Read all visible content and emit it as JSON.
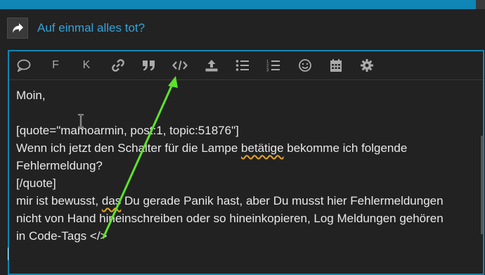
{
  "topic": {
    "title": "Auf einmal alles tot?",
    "reply_icon": "share-arrow-icon"
  },
  "toolbar": {
    "buttons": [
      {
        "name": "quote-bubble-icon",
        "label": ""
      },
      {
        "name": "bold-button",
        "label": "F"
      },
      {
        "name": "italic-button",
        "label": "K"
      },
      {
        "name": "link-icon",
        "label": ""
      },
      {
        "name": "blockquote-icon",
        "label": ""
      },
      {
        "name": "code-icon",
        "label": ""
      },
      {
        "name": "upload-icon",
        "label": ""
      },
      {
        "name": "bullet-list-icon",
        "label": ""
      },
      {
        "name": "numbered-list-icon",
        "label": ""
      },
      {
        "name": "emoji-icon",
        "label": ""
      },
      {
        "name": "calendar-icon",
        "label": ""
      },
      {
        "name": "gear-icon",
        "label": ""
      }
    ]
  },
  "editor": {
    "lines": {
      "l1": "Moin,",
      "l2": "",
      "l3": "[quote=\"mamoarmin, post:1, topic:51876\"]",
      "l4a": "Wenn ich jetzt den Schalter für die Lampe ",
      "l4b": "betätige",
      "l4c": " bekomme ich folgende",
      "l5": "Fehlermeldung?",
      "l6": "[/quote]",
      "l7a": "mir ist bewusst, ",
      "l7b": "das",
      "l7c": " Du gerade Panik hast, aber Du musst hier Fehlermeldungen",
      "l8": "nicht von Hand hineinschreiben oder so hineinkopieren, Log Meldungen gehören",
      "l9": "in Code-Tags </>"
    }
  },
  "colors": {
    "accent": "#0f86b5",
    "link": "#35a2d8",
    "annotation_arrow": "#5ee22a",
    "spell_underline": "#e5a427"
  }
}
